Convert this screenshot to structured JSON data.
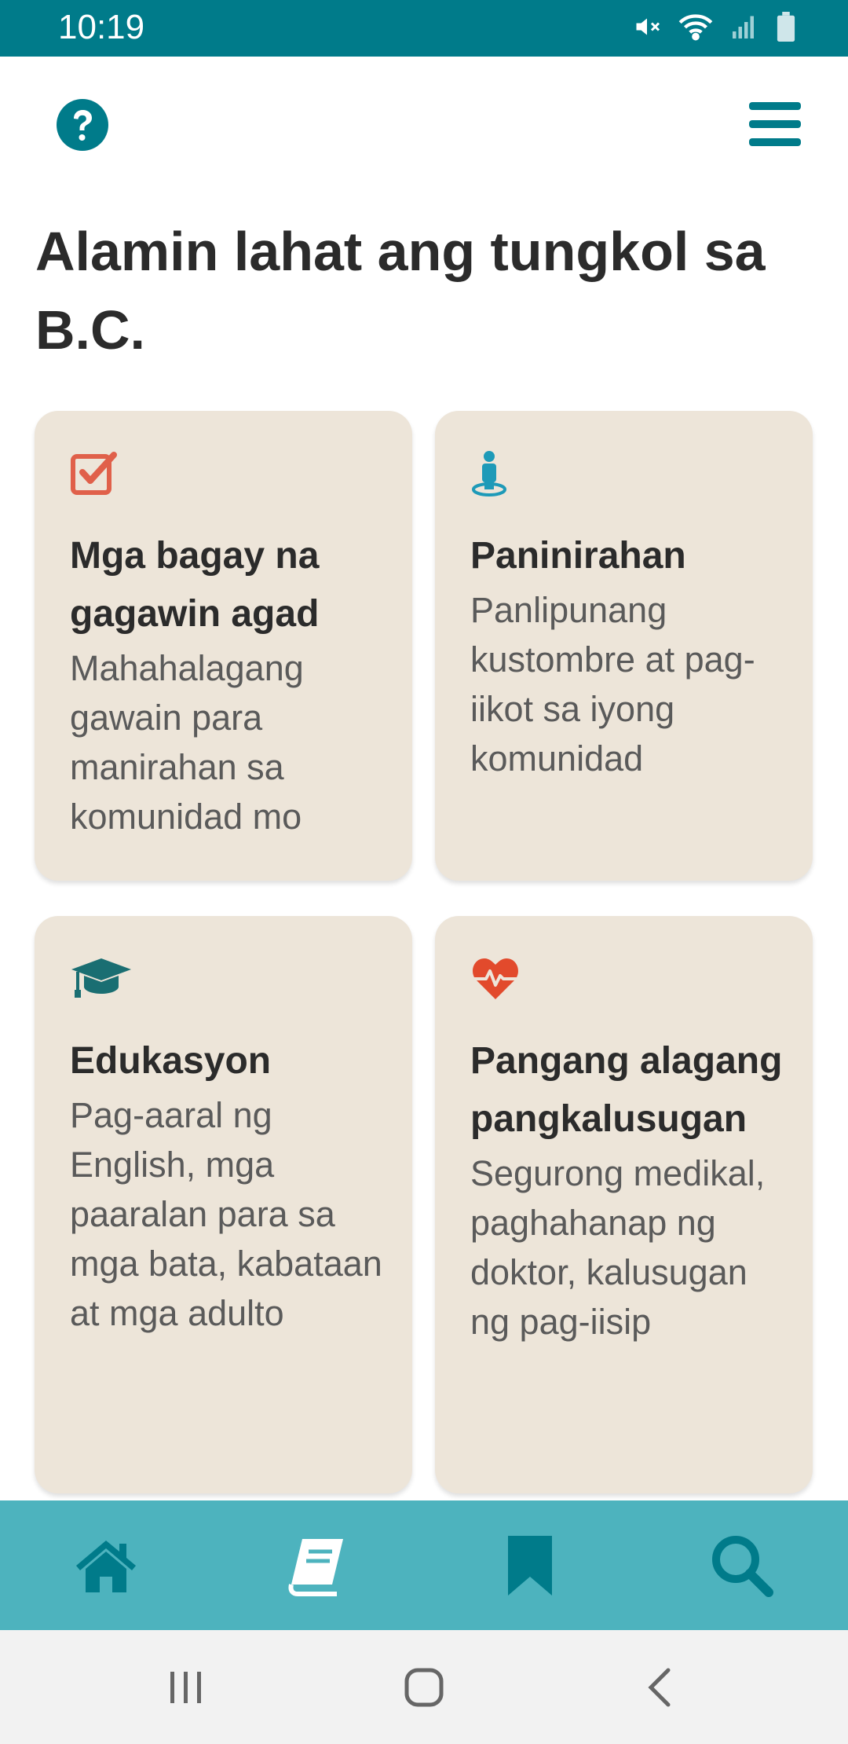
{
  "status_bar": {
    "time": "10:19",
    "icons": [
      "mute-icon",
      "wifi-icon",
      "signal-icon",
      "battery-icon"
    ]
  },
  "header": {
    "help_icon": "question-circle-icon",
    "menu_icon": "hamburger-menu-icon"
  },
  "page": {
    "title": "Alamin lahat ang tungkol sa B.C."
  },
  "cards": [
    {
      "icon": "checkbox-icon",
      "icon_color": "#e0604a",
      "title": "Mga bagay na gagawin agad",
      "description": "Mahahalagang gawain para manirahan sa komunidad mo"
    },
    {
      "icon": "person-location-icon",
      "icon_color": "#1e9ab8",
      "title": "Paninirahan",
      "description": "Panlipunang kustombre at pag-iikot sa iyong komunidad"
    },
    {
      "icon": "graduation-cap-icon",
      "icon_color": "#1a6e72",
      "title": "Edukasyon",
      "description": "Pag-aaral ng English, mga paaralan para sa mga bata, kabataan at mga adulto"
    },
    {
      "icon": "heart-pulse-icon",
      "icon_color": "#e24a2c",
      "title": "Pangang alagang pangkalusugan",
      "description": "Segurong medikal, paghahanap ng doktor, kalusugan ng pag-iisip"
    }
  ],
  "tab_bar": {
    "tabs": [
      {
        "icon": "home-icon",
        "active": false
      },
      {
        "icon": "book-icon",
        "active": true
      },
      {
        "icon": "bookmark-icon",
        "active": false
      },
      {
        "icon": "search-icon",
        "active": false
      }
    ]
  },
  "colors": {
    "primary": "#007b8a",
    "tab_bar": "#4db3be",
    "card_bg": "#ede5d9",
    "active_tab_icon": "#ffffff"
  }
}
